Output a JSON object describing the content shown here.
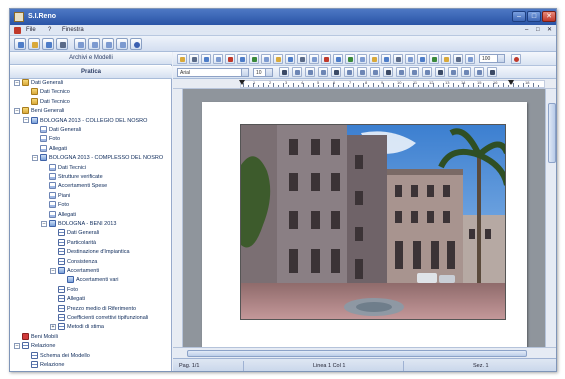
{
  "window": {
    "title": "S.I.Reno",
    "controls": {
      "minimize": "–",
      "maximize": "□",
      "close": "✕"
    }
  },
  "menubar": {
    "items": [
      "File",
      "?",
      "Finestra"
    ],
    "right_controls": [
      "–",
      "□",
      "✕"
    ]
  },
  "left_panel": {
    "header_top": "Archivi e Modelli",
    "header_bottom": "Pratica",
    "tree": [
      {
        "label": "Dati Generali",
        "icon": "folder-icon",
        "level": 0,
        "expander": "–"
      },
      {
        "label": "Dati Tecnico",
        "icon": "folder-icon",
        "level": 1
      },
      {
        "label": "Dati Tecnico",
        "icon": "folder-icon",
        "level": 1
      },
      {
        "label": "Beni Generali",
        "icon": "folder-icon",
        "level": 0,
        "expander": "–"
      },
      {
        "label": "BOLOGNA 2013 - COLLEGIO DEL NOSRO",
        "icon": "building-icon",
        "level": 1,
        "expander": "–"
      },
      {
        "label": "Dati Generali",
        "icon": "document-icon",
        "level": 2
      },
      {
        "label": "Foto",
        "icon": "document-icon",
        "level": 2
      },
      {
        "label": "Allegati",
        "icon": "document-icon",
        "level": 2
      },
      {
        "label": "BOLOGNA 2013 - COMPLESSO DEL NOSRO",
        "icon": "building-icon",
        "level": 2,
        "expander": "–"
      },
      {
        "label": "Dati Tecnici",
        "icon": "document-icon",
        "level": 3
      },
      {
        "label": "Strutture verificate",
        "icon": "document-icon",
        "level": 3
      },
      {
        "label": "Accertamenti Spese",
        "icon": "document-icon",
        "level": 3
      },
      {
        "label": "Piani",
        "icon": "document-icon",
        "level": 3
      },
      {
        "label": "Foto",
        "icon": "document-icon",
        "level": 3
      },
      {
        "label": "Allegati",
        "icon": "document-icon",
        "level": 3
      },
      {
        "label": "BOLOGNA - BENI 2013",
        "icon": "building-icon",
        "level": 3,
        "expander": "–"
      },
      {
        "label": "Dati Generali",
        "icon": "list-icon",
        "level": 4
      },
      {
        "label": "Particolarità",
        "icon": "list-icon",
        "level": 4
      },
      {
        "label": "Destinazione d'Impiantica",
        "icon": "list-icon",
        "level": 4
      },
      {
        "label": "Consistenza",
        "icon": "list-icon",
        "level": 4
      },
      {
        "label": "Accertamenti",
        "icon": "building-icon",
        "level": 4,
        "expander": "–"
      },
      {
        "label": "Accertamenti vari",
        "icon": "building-icon",
        "level": 5
      },
      {
        "label": "Foto",
        "icon": "list-icon",
        "level": 4
      },
      {
        "label": "Allegati",
        "icon": "list-icon",
        "level": 4
      },
      {
        "label": "Prezzo medio di Riferimento",
        "icon": "list-icon",
        "level": 4
      },
      {
        "label": "Coefficienti correttivi tipifunzionali",
        "icon": "list-icon",
        "level": 4
      },
      {
        "label": "Metodi di stima",
        "icon": "list-icon",
        "level": 4,
        "expander": "+"
      },
      {
        "label": "Beni Mobili",
        "icon": "red-icon",
        "level": 0
      },
      {
        "label": "Relazione",
        "icon": "list-icon",
        "level": 0,
        "expander": "–"
      },
      {
        "label": "Schema dei Modello",
        "icon": "list-icon",
        "level": 1
      },
      {
        "label": "Relazione",
        "icon": "list-icon",
        "level": 1
      }
    ]
  },
  "editor": {
    "font_name": "Arial",
    "font_size": "10",
    "zoom": "100",
    "ruler_numbers": [
      "1",
      "2",
      "3",
      "4",
      "5",
      "6",
      "7",
      "8",
      "9",
      "10",
      "11",
      "12",
      "13",
      "14",
      "15",
      "16",
      "17",
      "18"
    ]
  },
  "status_bar": {
    "page": "Pag. 1/1",
    "position": "Linea 1 Col 1",
    "section": "Sez. 1"
  },
  "colors": {
    "accent": "#2a54a6",
    "panel": "#e9eef6",
    "doc_background": "#8f959c"
  }
}
